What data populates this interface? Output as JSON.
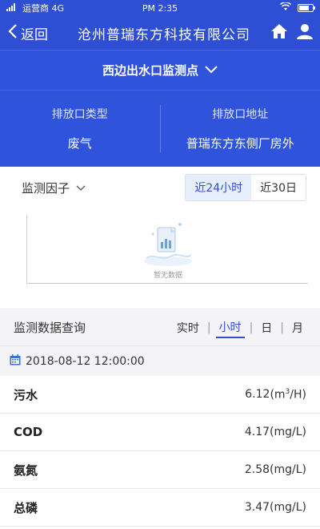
{
  "status": {
    "carrier": "运营商 4G",
    "time": "PM 2:35"
  },
  "nav": {
    "back_label": "返回",
    "title": "沧州普瑞东方科技有限公司"
  },
  "point": {
    "name": "西边出水口监测点"
  },
  "outlet": {
    "type_label": "排放口类型",
    "type_value": "废气",
    "address_label": "排放口地址",
    "address_value": "普瑞东方东侧厂房外"
  },
  "factor": {
    "label": "监测因子",
    "ranges": [
      "近24小时",
      "近30日"
    ],
    "active_range": 0
  },
  "chart": {
    "empty_text": "暂无数据"
  },
  "query": {
    "title": "监测数据查询",
    "tabs": [
      "实时",
      "小时",
      "日",
      "月"
    ],
    "active_tab": 1,
    "datetime": "2018-08-12 12:00:00"
  },
  "rows": [
    {
      "name": "污水",
      "value": "6.12",
      "unit_pre": "(m",
      "unit_sup": "3",
      "unit_post": "/H)"
    },
    {
      "name": "COD",
      "value": "4.17",
      "unit": "(mg/L)"
    },
    {
      "name": "氨氮",
      "value": "2.58",
      "unit": "(mg/L)"
    },
    {
      "name": "总磷",
      "value": "3.47",
      "unit": "(mg/L)"
    }
  ],
  "colors": {
    "brand": "#2e4fd3",
    "accent_bg": "#e7eefc"
  },
  "icons": [
    "signal-icon",
    "wifi-icon",
    "battery-icon",
    "back-chevron-icon",
    "home-icon",
    "user-icon",
    "chevron-down-icon",
    "calendar-icon",
    "empty-data-icon"
  ]
}
